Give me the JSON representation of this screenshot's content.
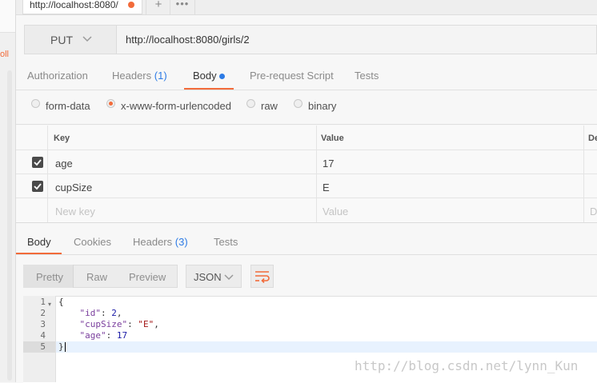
{
  "tab": {
    "title": "http://localhost:8080/",
    "add_label": "+",
    "more_label": "•••"
  },
  "left_strip": {
    "text": "oll"
  },
  "request": {
    "method": "PUT",
    "url": "http://localhost:8080/girls/2",
    "tabs": [
      {
        "label": "Authorization"
      },
      {
        "label": "Headers",
        "count": "(1)"
      },
      {
        "label": "Body"
      },
      {
        "label": "Pre-request Script"
      },
      {
        "label": "Tests"
      }
    ],
    "body_modes": [
      "form-data",
      "x-www-form-urlencoded",
      "raw",
      "binary"
    ],
    "selected_body_mode": "x-www-form-urlencoded"
  },
  "params_table": {
    "columns": [
      "Key",
      "Value",
      "De"
    ],
    "rows": [
      {
        "checked": true,
        "key": "age",
        "value": "17"
      },
      {
        "checked": true,
        "key": "cupSize",
        "value": "E"
      }
    ],
    "placeholder": {
      "key": "New key",
      "value": "Value",
      "desc": "D"
    }
  },
  "response": {
    "tabs": [
      {
        "label": "Body"
      },
      {
        "label": "Cookies"
      },
      {
        "label": "Headers",
        "count": "(3)"
      },
      {
        "label": "Tests"
      }
    ],
    "view_modes": [
      "Pretty",
      "Raw",
      "Preview"
    ],
    "format": "JSON",
    "line_numbers": [
      "1",
      "2",
      "3",
      "4",
      "5"
    ],
    "code": {
      "open": "{",
      "line2_key": "\"id\"",
      "line2_val": "2",
      "line3_key": "\"cupSize\"",
      "line3_val": "\"E\"",
      "line4_key": "\"age\"",
      "line4_val": "17",
      "close": "}"
    }
  },
  "watermark": "http://blog.csdn.net/lynn_Kun",
  "colors": {
    "accent_orange": "#f26b3a",
    "accent_blue": "#2d7be5"
  }
}
